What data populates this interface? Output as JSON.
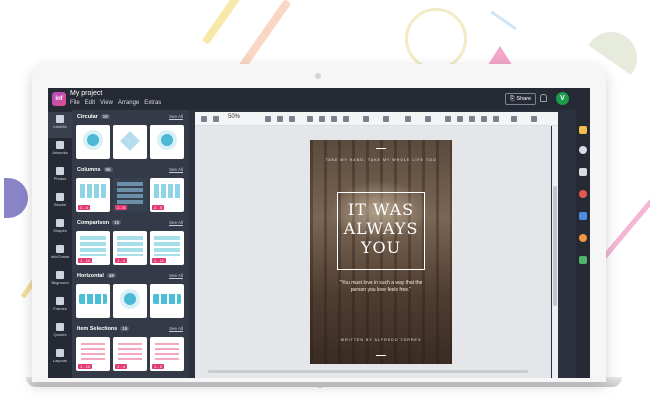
{
  "app": {
    "logo_text": "inf",
    "project_title": "My project",
    "menu": [
      "File",
      "Edit",
      "View",
      "Arrange",
      "Extras"
    ],
    "share_label": "Share",
    "avatar_initial": "V"
  },
  "iconbar": {
    "items": [
      {
        "label": "InfoKits",
        "icon": "infokits-icon"
      },
      {
        "label": "Artworks",
        "icon": "artworks-icon"
      },
      {
        "label": "Photos",
        "icon": "photos-icon"
      },
      {
        "label": "Blocks",
        "icon": "blocks-icon"
      },
      {
        "label": "Shapes",
        "icon": "shapes-icon"
      },
      {
        "label": "InfoCharts",
        "icon": "infocharts-icon"
      },
      {
        "label": "Bkground",
        "icon": "background-icon"
      },
      {
        "label": "Frames",
        "icon": "frames-icon"
      },
      {
        "label": "Quotes",
        "icon": "quotes-icon"
      },
      {
        "label": "Layouts",
        "icon": "layouts-icon"
      }
    ]
  },
  "panel": {
    "see_all": "See All",
    "sections": [
      {
        "title": "Circular",
        "count": "19",
        "tags": [
          "",
          "",
          ""
        ]
      },
      {
        "title": "Columns",
        "count": "55",
        "tags": [
          "2 - 4",
          "1 - 5",
          "2 - 5"
        ]
      },
      {
        "title": "Comparison",
        "count": "15",
        "tags": [
          "1 - 10",
          "1 - 4",
          "1 - 11"
        ]
      },
      {
        "title": "Horizontal",
        "count": "48",
        "tags": [
          "",
          "",
          ""
        ]
      },
      {
        "title": "Item Selections",
        "count": "15",
        "tags": [
          "1 - 10",
          "1 - 4",
          "1 - 5"
        ]
      }
    ]
  },
  "toolbar": {
    "zoom": "50%"
  },
  "poster": {
    "tagline": "TAKE MY HAND, TAKE MY WHOLE LIFE TOO",
    "title_lines": [
      "IT WAS",
      "ALWAYS",
      "YOU"
    ],
    "quote": "\"You must love in such a way that the person you love feels free.\"",
    "author": "WRITTEN BY ALFREDO TORRES"
  },
  "colors": {
    "brand_gradient_start": "#b14fc5",
    "brand_gradient_end": "#e04f8a",
    "tag_pink": "#e23b73",
    "avatar_green": "#1d9a4b",
    "dark_ui": "#2c313d"
  }
}
